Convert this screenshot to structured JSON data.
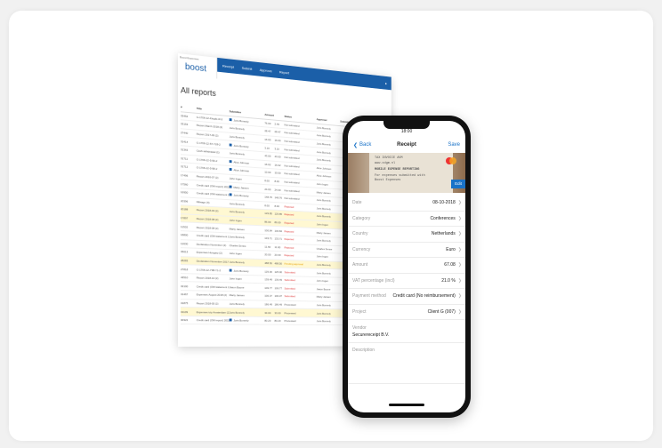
{
  "desktop": {
    "logo_sub": "Boost Expenses",
    "logo": "boost",
    "nav": [
      "Receipt",
      "Submit",
      "Approve",
      "Report"
    ],
    "title": "All reports",
    "headers": [
      "#",
      "Title",
      "Submitter",
      "Amount",
      "Status",
      "Approver",
      "Submitted on"
    ],
    "rows": [
      {
        "id": "33452",
        "title": "G-1706-12-Kinglie-R-2",
        "sub": "Joris Bonnely",
        "amt": "76.00",
        "val": "2.49",
        "status": "Not submitted",
        "appr": "Joris Bonnely",
        "hl": false,
        "sq": true,
        "cls": ""
      },
      {
        "id": "33153",
        "title": "Report March 2018 (2)",
        "sub": "Joris Bonnely",
        "amt": "28.47",
        "val": "28.47",
        "status": "Not submitted",
        "appr": "Joris Bonnely",
        "hl": false,
        "sq": false,
        "cls": ""
      },
      {
        "id": "27440",
        "title": "Report 2017-06 (2)",
        "sub": "Joris Bonnely",
        "amt": "16.00",
        "val": "16.00",
        "status": "Not submitted",
        "appr": "Joris Bonnely",
        "hl": false,
        "sq": false,
        "cls": ""
      },
      {
        "id": "31414",
        "title": "G-1706-12-57-Y28-2",
        "sub": "Joris Bonnely",
        "amt": "3.10",
        "val": "3.10",
        "status": "Not submitted",
        "appr": "Joris Bonnely",
        "hl": false,
        "sq": true,
        "cls": ""
      },
      {
        "id": "31363",
        "title": "Cash withdrawal (1)",
        "sub": "Joris Bonnely",
        "amt": "43.00",
        "val": "43.00",
        "status": "Not submitted",
        "appr": "Joris Bonnely",
        "hl": false,
        "sq": false,
        "cls": ""
      },
      {
        "id": "31711",
        "title": "G-1706-12-5-99-2",
        "sub": "Alice Johnson",
        "amt": "16.02",
        "val": "16.02",
        "status": "Not submitted",
        "appr": "Alice Johnson",
        "hl": false,
        "sq": true,
        "cls": ""
      },
      {
        "id": "31712",
        "title": "G-1706-12-5-98-2",
        "sub": "Alice Johnson",
        "amt": "10.00",
        "val": "10.00",
        "status": "Not submitted",
        "appr": "Alice Johnson",
        "hl": false,
        "sq": true,
        "cls": ""
      },
      {
        "id": "17496",
        "title": "Report 2016-07 (2)",
        "sub": "John Ingen",
        "amt": "8.00",
        "val": "8.00",
        "status": "Not submitted",
        "appr": "John Ingen",
        "hl": false,
        "sq": false,
        "cls": ""
      },
      {
        "id": "17560",
        "title": "Credit card (OM report) 2011 (2)",
        "sub": "Marty Jansen",
        "amt": "24.00",
        "val": "24.00",
        "status": "Not submitted",
        "appr": "Marty Jansen",
        "hl": false,
        "sq": true,
        "cls": ""
      },
      {
        "id": "16950",
        "title": "Credit card (OM statement 1_2018)",
        "sub": "Joris Bonnely",
        "amt": "148.76",
        "val": "148.76",
        "status": "Not submitted",
        "appr": "Joris Bonnely",
        "hl": false,
        "sq": true,
        "cls": ""
      },
      {
        "id": "20396",
        "title": "Mileage (4)",
        "sub": "Joris Bonnely",
        "amt": "8.00",
        "val": "8.00",
        "status": "Rejected",
        "appr": "Joris Bonnely",
        "hl": false,
        "sq": false,
        "cls": "red"
      },
      {
        "id": "20188",
        "title": "Report 2018-03 (2)",
        "sub": "Joris Bonnely",
        "amt": "129.85",
        "val": "129.85",
        "status": "Rejected",
        "appr": "Joris Bonnely",
        "hl": true,
        "sq": false,
        "cls": "red"
      },
      {
        "id": "17897",
        "title": "Report 2018-08 (2)",
        "sub": "John Ingen",
        "amt": "86.09",
        "val": "86.09",
        "status": "Rejected",
        "appr": "John Ingen",
        "hl": true,
        "sq": false,
        "cls": "red"
      },
      {
        "id": "11502",
        "title": "Report 2018-08 (2)",
        "sub": "Marty Jansen",
        "amt": "100.84",
        "val": "100.84",
        "status": "Rejected",
        "appr": "Marty Jansen",
        "hl": false,
        "sq": false,
        "cls": "red"
      },
      {
        "id": "18800",
        "title": "Credit card (OM statement 1_2018)",
        "sub": "Joris Bonnely",
        "amt": "133.71",
        "val": "133.71",
        "status": "Rejected",
        "appr": "Joris Bonnely",
        "hl": false,
        "sq": false,
        "cls": "red"
      },
      {
        "id": "12630",
        "title": "Declaration November (2)",
        "sub": "Charles Senne",
        "amt": "11.60",
        "val": "11.60",
        "status": "Rejected",
        "appr": "Charles Senne",
        "hl": false,
        "sq": false,
        "cls": "red"
      },
      {
        "id": "35613",
        "title": "Expenses Hungary (2)",
        "sub": "John Ingen",
        "amt": "20.00",
        "val": "20.00",
        "status": "Rejected",
        "appr": "John Ingen",
        "hl": false,
        "sq": false,
        "cls": "red"
      },
      {
        "id": "28283",
        "title": "Declaration November 2017 (2)",
        "sub": "Joris Bonnely",
        "amt": "488.50",
        "val": "488.50",
        "status": "Pending approval",
        "appr": "Joris Bonnely",
        "hl": true,
        "sq": false,
        "cls": "org"
      },
      {
        "id": "27818",
        "title": "G-1706-12-Y98-Y1-2",
        "sub": "Joris Bonnely",
        "amt": "125.00",
        "val": "125.00",
        "status": "Submitted",
        "appr": "Joris Bonnely",
        "hl": false,
        "sq": true,
        "cls": "red"
      },
      {
        "id": "43510",
        "title": "Report 2018-10 (2)",
        "sub": "John Ingen",
        "amt": "139.49",
        "val": "139.49",
        "status": "Submitted",
        "appr": "John Ingen",
        "hl": false,
        "sq": false,
        "cls": "red"
      },
      {
        "id": "32100",
        "title": "Credit card (OM statement 1_2018)",
        "sub": "Jason Boone",
        "amt": "109.77",
        "val": "109.77",
        "status": "Submitted",
        "appr": "Jason Boone",
        "hl": false,
        "sq": false,
        "cls": "red"
      },
      {
        "id": "31467",
        "title": "Expenses August 2018 (2)",
        "sub": "Marty Jansen",
        "amt": "100.37",
        "val": "100.37",
        "status": "Submitted",
        "appr": "Marty Jansen",
        "hl": false,
        "sq": false,
        "cls": "red"
      },
      {
        "id": "31875",
        "title": "Report 2018-05 (2)",
        "sub": "Joris Bonnely",
        "amt": "186.49",
        "val": "186.49",
        "status": "Processed",
        "appr": "Joris Bonnely",
        "hl": false,
        "sq": false,
        "cls": ""
      },
      {
        "id": "31109",
        "title": "Expenses trip Amsterdam (2)",
        "sub": "Joris Bonnely",
        "amt": "33.00",
        "val": "33.00",
        "status": "Processed",
        "appr": "Joris Bonnely",
        "hl": true,
        "sq": false,
        "cls": ""
      },
      {
        "id": "30322",
        "title": "Credit card (OM report) 2011 (2)",
        "sub": "Joris Bonnely",
        "amt": "80.20",
        "val": "80.20",
        "status": "Processed",
        "appr": "Joris Bonnely",
        "hl": false,
        "sq": true,
        "cls": ""
      }
    ]
  },
  "phone": {
    "time": "18:00",
    "back_label": "Back",
    "title": "Receipt",
    "save_label": "Save",
    "edit_label": "Edit",
    "receipt_text": [
      "TAX INVOICE AVM",
      "www.xdgm.nl",
      "MOBILE EXPENSE REPORTING",
      "For expenses submitted with",
      "Boost Expenses"
    ],
    "fields": [
      {
        "label": "Date",
        "value": "08-10-2018",
        "chevron": true
      },
      {
        "label": "Category",
        "value": "Conferences",
        "chevron": true
      },
      {
        "label": "Country",
        "value": "Netherlands",
        "chevron": true
      },
      {
        "label": "Currency",
        "value": "Euro",
        "chevron": true
      },
      {
        "label": "Amount",
        "value": "67.08",
        "chevron": true
      },
      {
        "label": "VAT percentage (incl)",
        "value": "21.0 %",
        "chevron": true
      },
      {
        "label": "Payment method",
        "value": "Credit card (No reimbursement)",
        "chevron": true
      },
      {
        "label": "Project",
        "value": "Client G (007)",
        "chevron": true
      }
    ],
    "vendor": {
      "label": "Vendor",
      "value": "Securereceipt B.V."
    },
    "description": {
      "label": "Description",
      "value": ""
    },
    "colors": {
      "accent": "#1a73c8",
      "nav": "#1b5fa8",
      "highlight": "#fff8d2"
    }
  }
}
